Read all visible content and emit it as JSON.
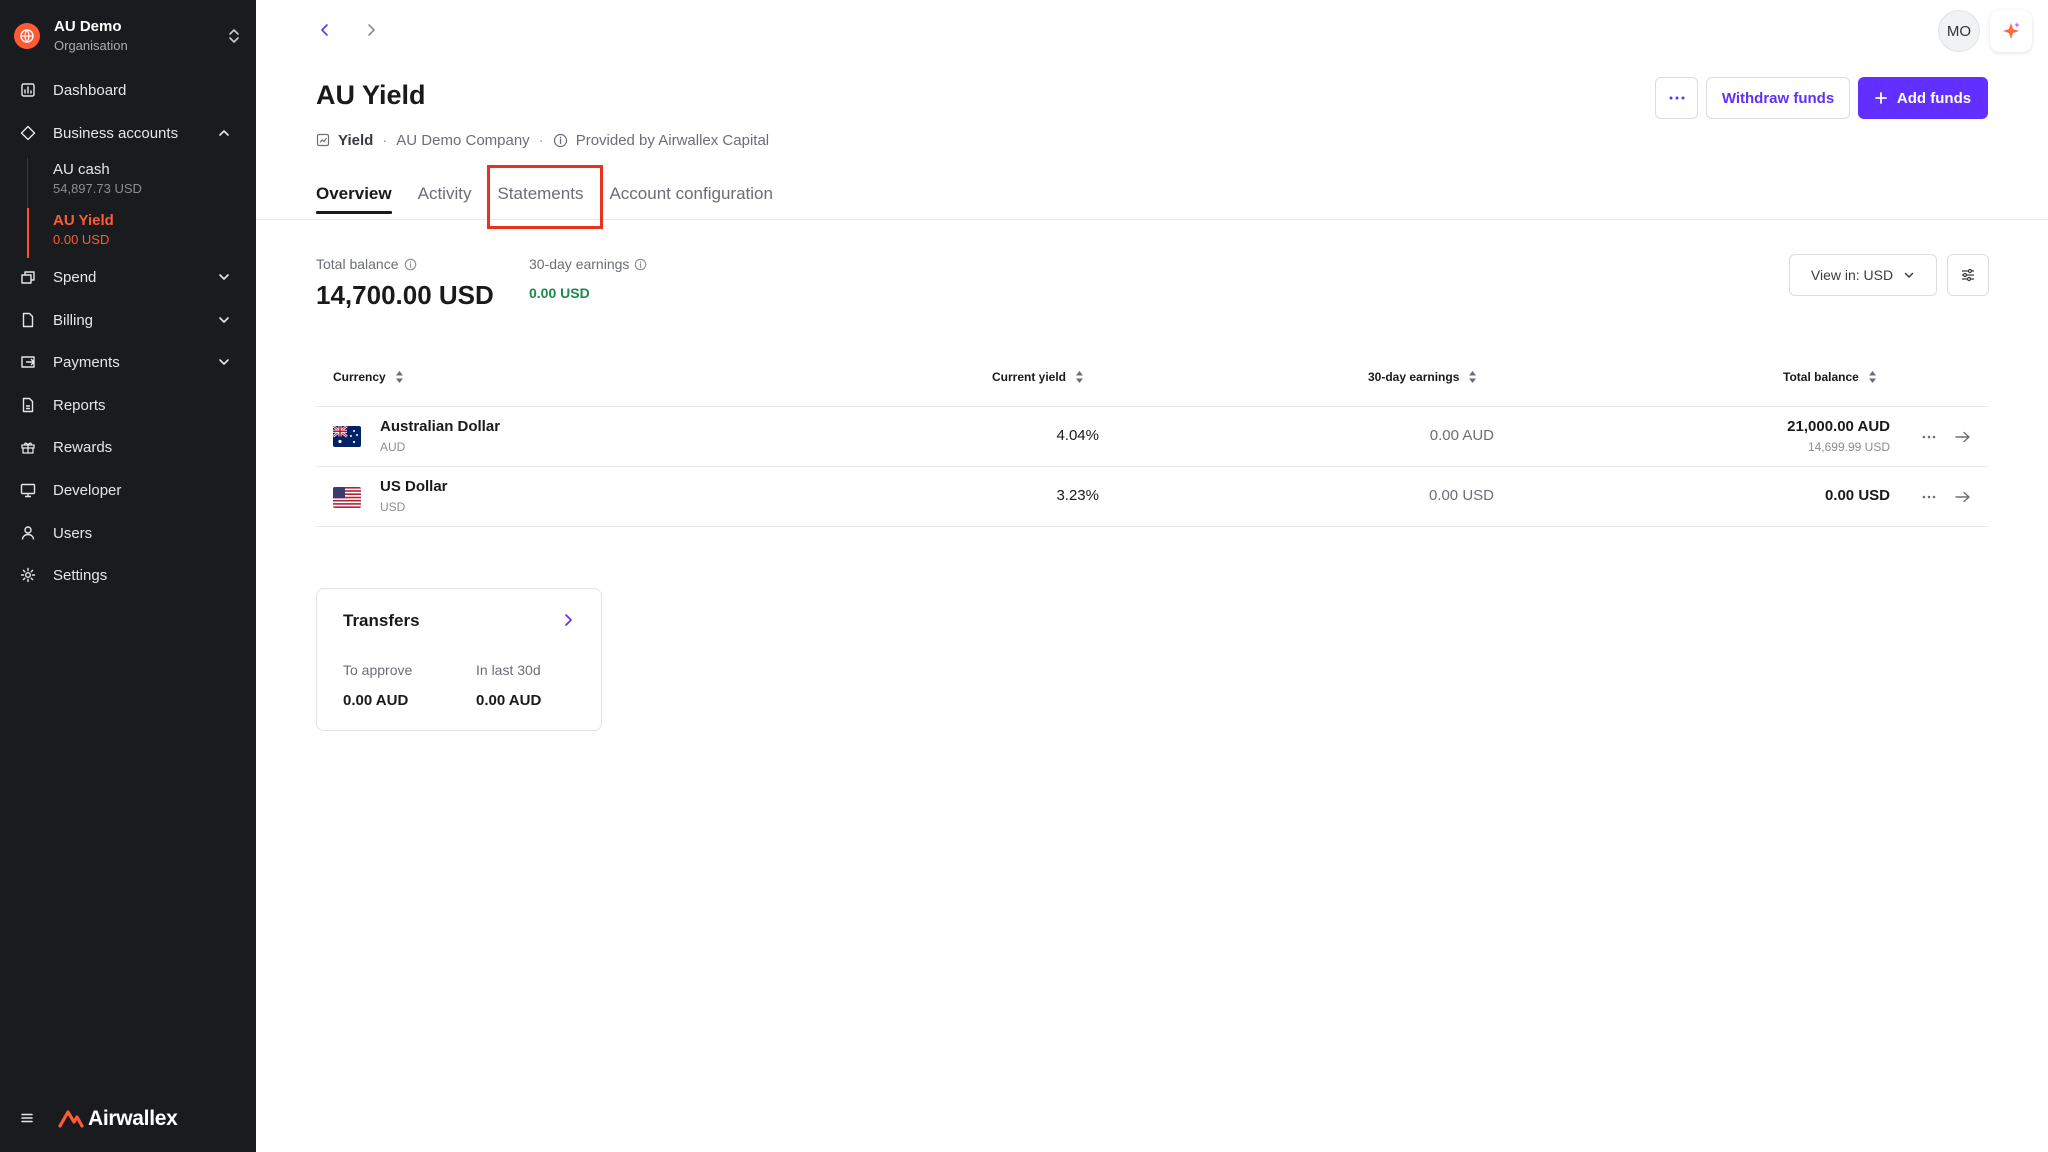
{
  "organisation": {
    "name": "AU Demo",
    "type": "Organisation"
  },
  "sidebar": {
    "items": [
      {
        "label": "Dashboard"
      },
      {
        "label": "Business accounts"
      },
      {
        "label": "Spend"
      },
      {
        "label": "Billing"
      },
      {
        "label": "Payments"
      },
      {
        "label": "Reports"
      },
      {
        "label": "Rewards"
      },
      {
        "label": "Developer"
      },
      {
        "label": "Users"
      },
      {
        "label": "Settings"
      }
    ],
    "accounts": [
      {
        "name": "AU cash",
        "value": "54,897.73 USD"
      },
      {
        "name": "AU Yield",
        "value": "0.00 USD"
      }
    ],
    "brand": "Airwallex"
  },
  "user": {
    "initials": "MO"
  },
  "header": {
    "title": "AU Yield",
    "meta": {
      "type": "Yield",
      "company": "AU Demo Company",
      "provider": "Provided by Airwallex Capital"
    },
    "more_label": "···",
    "withdraw_label": "Withdraw funds",
    "add_label": "Add funds"
  },
  "tabs": [
    {
      "label": "Overview"
    },
    {
      "label": "Activity"
    },
    {
      "label": "Statements"
    },
    {
      "label": "Account configuration"
    }
  ],
  "balance": {
    "total_label": "Total balance",
    "total_value": "14,700.00 USD",
    "earnings_label": "30-day earnings",
    "earnings_value": "0.00 USD",
    "view_label": "View in: USD"
  },
  "table": {
    "headers": {
      "currency": "Currency",
      "yield": "Current yield",
      "earnings": "30-day earnings",
      "total": "Total balance"
    },
    "rows": [
      {
        "name": "Australian Dollar",
        "code": "AUD",
        "yield": "4.04%",
        "earnings": "0.00 AUD",
        "total": "21,000.00 AUD",
        "total_sub": "14,699.99 USD"
      },
      {
        "name": "US Dollar",
        "code": "USD",
        "yield": "3.23%",
        "earnings": "0.00 USD",
        "total": "0.00 USD",
        "total_sub": ""
      }
    ]
  },
  "transfers": {
    "title": "Transfers",
    "to_approve_label": "To approve",
    "to_approve_value": "0.00 AUD",
    "last30_label": "In last 30d",
    "last30_value": "0.00 AUD"
  },
  "colors": {
    "accent": "#612fff",
    "brand": "#ff5a36",
    "positive": "#1b8a4b",
    "highlight": "#e8321f",
    "sidebar_bg": "#1a1b1e"
  }
}
